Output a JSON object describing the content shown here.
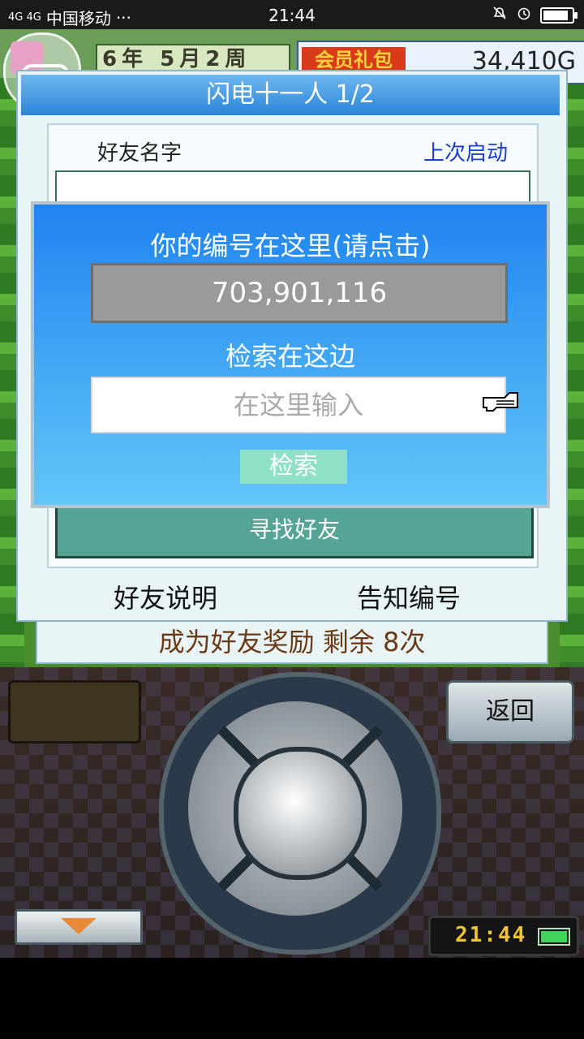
{
  "status_bar": {
    "carrier": "中国移动",
    "dots": "···",
    "signal": "4G 4G",
    "time": "21:44"
  },
  "game_top": {
    "date": "6年 5月2周",
    "vip_badge": "会员礼包",
    "money": "34,410G"
  },
  "panel": {
    "title": "闪电十一人 1/2",
    "col_friend_name": "好友名字",
    "col_last_launch": "上次启动",
    "find_friends": "寻找好友",
    "friend_info": "好友说明",
    "tell_id": "告知编号"
  },
  "reward_bar": "成为好友奖励 剩余 8次",
  "modal": {
    "title": "你的编号在这里(请点击)",
    "id_value": "703,901,116",
    "search_title": "检索在这边",
    "input_placeholder": "在这里输入",
    "search_button": "检索"
  },
  "controller": {
    "back_button": "返回",
    "clock": "21:44"
  },
  "colors": {
    "modal_top": "#1f84f0",
    "modal_bottom": "#62c6f8",
    "find_button": "#55a496",
    "link_blue": "#1a3fd0"
  }
}
